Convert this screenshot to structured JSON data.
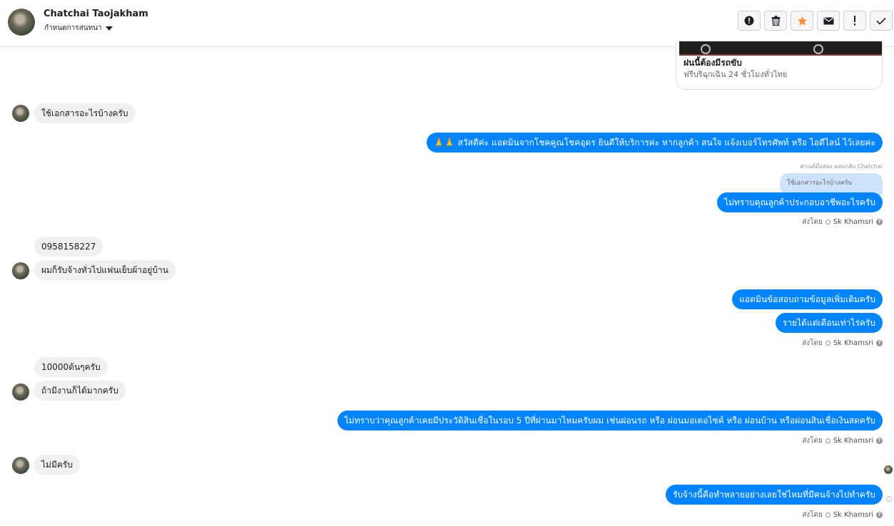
{
  "header": {
    "contact_name": "Chatchai Taojakham",
    "subtitle": "กำหนดการสนทนา",
    "toolbar": [
      {
        "name": "alert-circle-icon"
      },
      {
        "name": "trash-icon"
      },
      {
        "name": "star-icon",
        "color": "#f7923b"
      },
      {
        "name": "envelope-icon"
      },
      {
        "name": "exclamation-icon"
      },
      {
        "name": "checkmark-icon"
      }
    ]
  },
  "ad_card": {
    "title": "ฝนนี้ต้องมีรถขับ",
    "subtitle": "ฟรีบริฉุกเฉิน 24 ชั่วโมงทั่วไทย"
  },
  "messages": {
    "m1": "ใช้เอกสารอะไรบ้างครับ",
    "m2": "🙏🙏 สวัสดีค่ะ แอดมินจากโชคคูณโชคอุดร ยินดีให้บริการค่ะ หากลูกค้า สนใจ แจ้งเบอร์โทรศัพท์ หรือ ไอดีไลน์ ไว้เลยค่ะ",
    "reply_note": "ศรณย์มือสอง ตอบกลับ Chatchai",
    "reply_quote": "ใช้เอกสารอะไรบ้างครับ",
    "m3": "ไม่ทราบคุณลูกค้าประกอบอาชีพอะไรครับ",
    "m4": "0958158227",
    "m5": "ผมก็รับจ้างทั่วไปแฟนเย็บผ้าอยู่บ้าน",
    "m6": "แอดมินข้อสอบถามข้อมูลเพิ่มเติมครับ",
    "m7": "รายได้แต่เดือนเท่าไร่ครับ",
    "m8": "10000ต้นๆครับ",
    "m9": "ถ้ามีงานก็ได้มากครับ",
    "m10": "ไม่ทราบว่าคุณลูกค้าเคยมีประวัติสินเชื่อในรอบ 5 ปีที่ผ่านมาไหมครับผม เช่นผ่อนรถ หรือ ผ่อนมอเตอไซค์ หรือ ผ่อนบ้าน หรือผ่อนสินเชื่อเงินสดครับ",
    "m11": "ไม่มีครับ",
    "m12": "รับจ้างนี้คือทำหลายอย่างเลยใช่ไหมที่มีคนจ้างไปทำครับ"
  },
  "sent_by": {
    "label": "ส่งโดย",
    "agent": "Sk Khamsri"
  }
}
